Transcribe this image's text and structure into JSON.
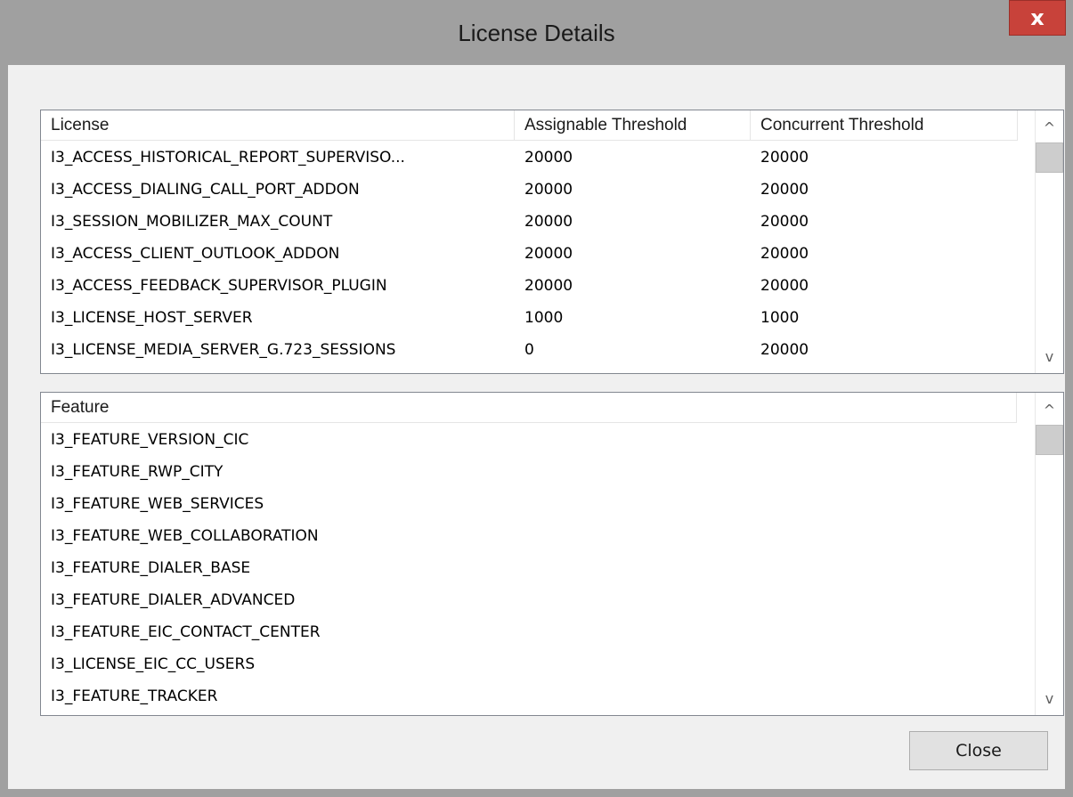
{
  "window": {
    "title": "License Details",
    "close_glyph": "x"
  },
  "license_table": {
    "columns": [
      "License",
      "Assignable Threshold",
      "Concurrent Threshold"
    ],
    "rows": [
      [
        "I3_ACCESS_HISTORICAL_REPORT_SUPERVISO...",
        "20000",
        "20000"
      ],
      [
        "I3_ACCESS_DIALING_CALL_PORT_ADDON",
        "20000",
        "20000"
      ],
      [
        "I3_SESSION_MOBILIZER_MAX_COUNT",
        "20000",
        "20000"
      ],
      [
        "I3_ACCESS_CLIENT_OUTLOOK_ADDON",
        "20000",
        "20000"
      ],
      [
        "I3_ACCESS_FEEDBACK_SUPERVISOR_PLUGIN",
        "20000",
        "20000"
      ],
      [
        "I3_LICENSE_HOST_SERVER",
        "1000",
        "1000"
      ],
      [
        "I3_LICENSE_MEDIA_SERVER_G.723_SESSIONS",
        "0",
        "20000"
      ]
    ]
  },
  "feature_table": {
    "columns": [
      "Feature"
    ],
    "rows": [
      "I3_FEATURE_VERSION_CIC",
      "I3_FEATURE_RWP_CITY",
      "I3_FEATURE_WEB_SERVICES",
      "I3_FEATURE_WEB_COLLABORATION",
      "I3_FEATURE_DIALER_BASE",
      "I3_FEATURE_DIALER_ADVANCED",
      "I3_FEATURE_EIC_CONTACT_CENTER",
      "I3_LICENSE_EIC_CC_USERS",
      "I3_FEATURE_TRACKER"
    ]
  },
  "scroll_glyphs": {
    "up": "^",
    "down": "v"
  },
  "buttons": {
    "close_label": "Close"
  },
  "icons": {
    "window_close": "close-icon",
    "scroll_up": "chevron-up-icon",
    "scroll_down": "chevron-down-icon"
  },
  "colors": {
    "frame": "#a0a0a0",
    "close_button_bg": "#c8423a",
    "client_bg": "#f0f0f0",
    "list_bg": "#ffffff"
  }
}
